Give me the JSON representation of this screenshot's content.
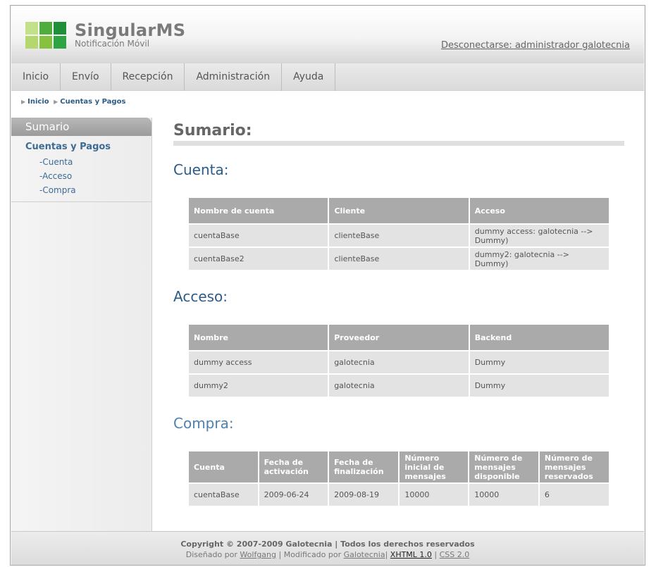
{
  "header": {
    "brand_title": "SingularMS",
    "brand_subtitle": "Notificación Móvil",
    "logout_link": "Desconectarse: administrador galotecnia"
  },
  "nav": {
    "items": [
      "Inicio",
      "Envío",
      "Recepción",
      "Administración",
      "Ayuda"
    ]
  },
  "breadcrumb": {
    "items": [
      "Inicio",
      "Cuentas y Pagos"
    ]
  },
  "sidebar": {
    "header": "Sumario",
    "section_title": "Cuentas y Pagos",
    "links": [
      "-Cuenta",
      "-Acceso",
      "-Compra"
    ]
  },
  "main": {
    "title": "Sumario:",
    "cuenta": {
      "title": "Cuenta:",
      "columns": [
        "Nombre de cuenta",
        "Cliente",
        "Acceso"
      ],
      "rows": [
        [
          "cuentaBase",
          "clienteBase",
          "dummy access: galotecnia --> Dummy)"
        ],
        [
          "cuentaBase2",
          "clienteBase",
          "dummy2: galotecnia --> Dummy)"
        ]
      ]
    },
    "acceso": {
      "title": "Acceso:",
      "columns": [
        "Nombre",
        "Proveedor",
        "Backend"
      ],
      "rows": [
        [
          "dummy access",
          "galotecnia",
          "Dummy"
        ],
        [
          "dummy2",
          "galotecnia",
          "Dummy"
        ]
      ]
    },
    "compra": {
      "title": "Compra:",
      "columns": [
        "Cuenta",
        "Fecha de activación",
        "Fecha de finalización",
        "Número inicial de mensajes",
        "Número de mensajes disponible",
        "Número de mensajes reservados"
      ],
      "rows": [
        [
          "cuentaBase",
          "2009-06-24",
          "2009-08-19",
          "10000",
          "10000",
          "6"
        ]
      ]
    }
  },
  "footer": {
    "copyright": "Copyright © 2007-2009 Galotecnia | Todos los derechos reservados",
    "designed_by": "Diseñado por",
    "designer": "Wolfgang",
    "modified_by": "Modificado por",
    "modifier": "Galotecnia",
    "xhtml": "XHTML 1.0",
    "css": "CSS 2.0"
  },
  "colors": {
    "accent": "#2b5c88",
    "logo_light": "#b5d86e",
    "logo_mid": "#7ec242",
    "logo_dark": "#1f9a3e",
    "table_header": "#aaaaaa",
    "table_cell": "#e3e3e3"
  }
}
